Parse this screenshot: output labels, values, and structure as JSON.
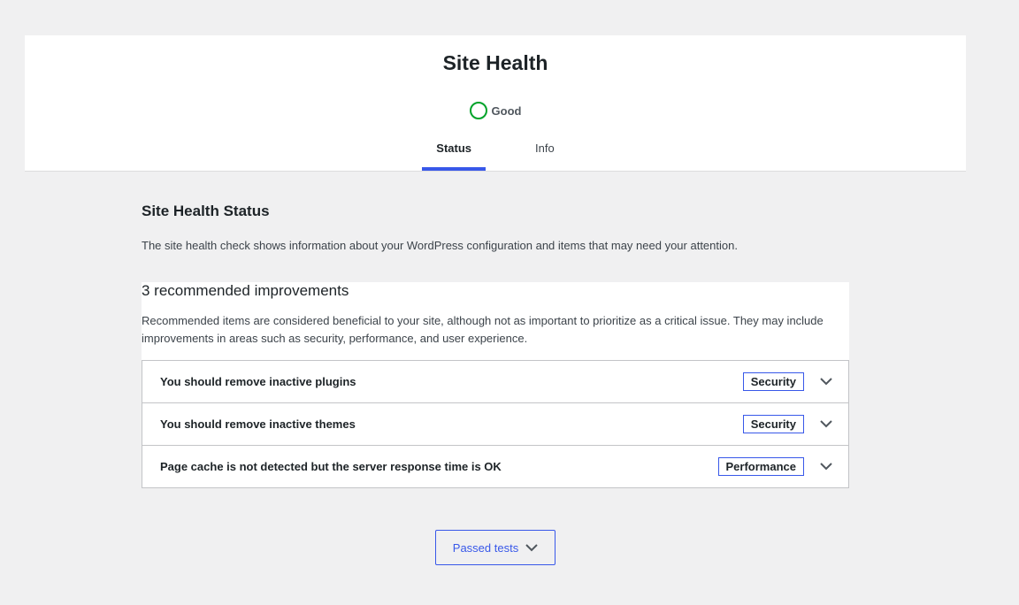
{
  "header": {
    "title": "Site Health",
    "status_label": "Good",
    "status_color": "#00a32a",
    "tabs": [
      {
        "label": "Status",
        "active": true
      },
      {
        "label": "Info",
        "active": false
      }
    ],
    "accent": "#3858e9"
  },
  "main": {
    "title": "Site Health Status",
    "description": "The site health check shows information about your WordPress configuration and items that may need your attention.",
    "improvements": {
      "heading": "3 recommended improvements",
      "description": "Recommended items are considered beneficial to your site, although not as important to prioritize as a critical issue. They may include improvements in areas such as security, performance, and user experience.",
      "items": [
        {
          "title": "You should remove inactive plugins",
          "badge": "Security",
          "icon": "chevron-down-icon"
        },
        {
          "title": "You should remove inactive themes",
          "badge": "Security",
          "icon": "chevron-down-icon"
        },
        {
          "title": "Page cache is not detected but the server response time is OK",
          "badge": "Performance",
          "icon": "chevron-down-icon"
        }
      ]
    }
  },
  "footer": {
    "passed_tests_label": "Passed tests",
    "icon": "chevron-down-icon"
  }
}
